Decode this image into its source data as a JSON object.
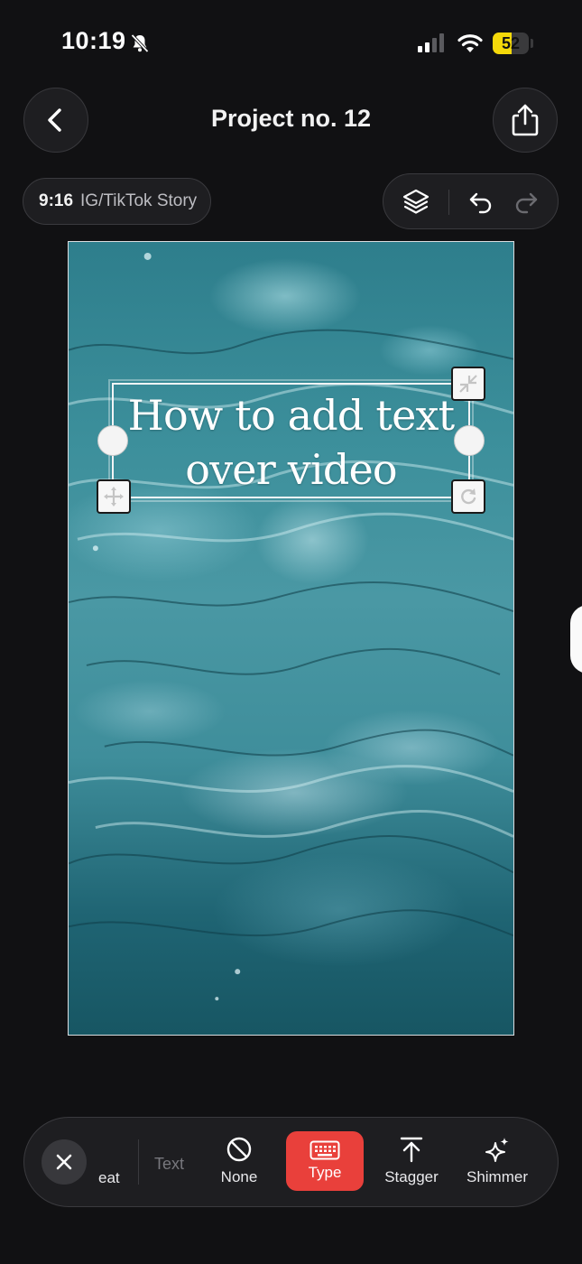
{
  "status_bar": {
    "time": "10:19",
    "battery_level": "52",
    "battery_fraction": 0.52,
    "icons": [
      "bell-muted-icon",
      "cellular-signal-icon",
      "wifi-icon",
      "battery-icon"
    ]
  },
  "header": {
    "title": "Project no. 12",
    "back_icon": "chevron-left-icon",
    "share_icon": "share-icon"
  },
  "format": {
    "ratio": "9:16",
    "name": "IG/TikTok Story"
  },
  "toolbar": {
    "icons": [
      "layers-icon",
      "undo-icon",
      "redo-icon"
    ]
  },
  "canvas": {
    "overlay_text_line1": "How to add text",
    "overlay_text_line2": "over video",
    "handle_icons": [
      "resize-icon",
      "move-icon",
      "rotate-icon"
    ]
  },
  "animation_bar": {
    "close_icon": "close-icon",
    "partial_label": "eat",
    "section_label": "Text",
    "options": [
      {
        "label": "None",
        "icon": "none-icon",
        "selected": false
      },
      {
        "label": "Type",
        "icon": "keyboard-icon",
        "selected": true
      },
      {
        "label": "Stagger",
        "icon": "arrow-up-bar-icon",
        "selected": false
      },
      {
        "label": "Shimmer",
        "icon": "sparkle-icon",
        "selected": false
      }
    ],
    "accent_color": "#e9403b"
  }
}
